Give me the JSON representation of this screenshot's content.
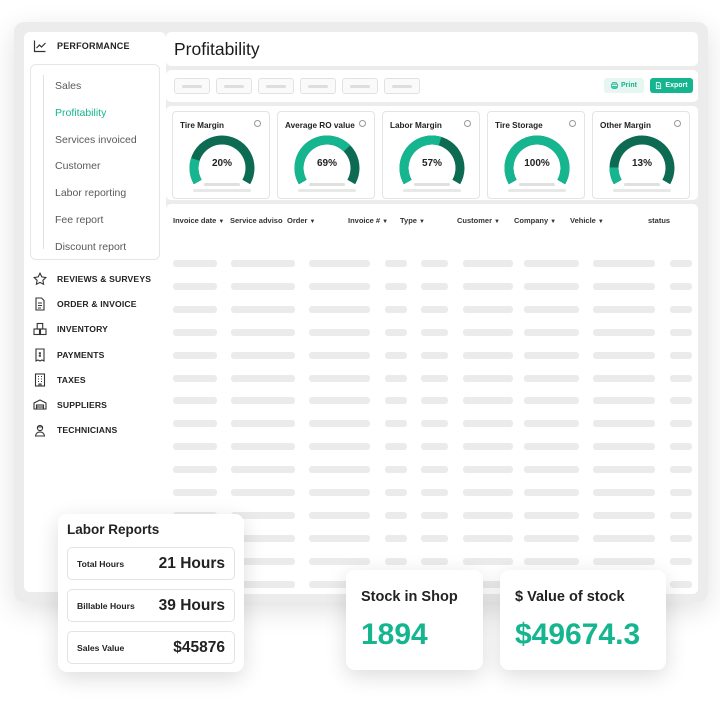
{
  "colors": {
    "accent": "#14b58f",
    "accent_dark": "#0d6b53",
    "accent_light": "#e6f6f1"
  },
  "sidebar": {
    "header": {
      "label": "PERFORMANCE",
      "icon": "trend-chart-icon"
    },
    "submenu": [
      {
        "label": "Sales"
      },
      {
        "label": "Profitability",
        "active": true
      },
      {
        "label": "Services invoiced"
      },
      {
        "label": "Customer"
      },
      {
        "label": "Labor reporting"
      },
      {
        "label": "Fee report"
      },
      {
        "label": "Discount report"
      }
    ],
    "items": [
      {
        "label": "REVIEWS & SURVEYS",
        "icon": "star-icon"
      },
      {
        "label": "ORDER & INVOICE",
        "icon": "document-icon"
      },
      {
        "label": "INVENTORY",
        "icon": "boxes-icon"
      },
      {
        "label": "PAYMENTS",
        "icon": "receipt-icon"
      },
      {
        "label": "TAXES",
        "icon": "building-icon"
      },
      {
        "label": "SUPPLIERS",
        "icon": "truck-icon"
      },
      {
        "label": "TECHNICIANS",
        "icon": "technician-icon"
      }
    ]
  },
  "page": {
    "title": "Profitability"
  },
  "toolbar": {
    "print_label": "Print",
    "export_label": "Export"
  },
  "kpis": [
    {
      "title": "Tire Margin",
      "value": "20%",
      "fill": 0.2
    },
    {
      "title": "Average RO value",
      "value": "69%",
      "fill": 0.69
    },
    {
      "title": "Labor Margin",
      "value": "57%",
      "fill": 0.57
    },
    {
      "title": "Tire Storage",
      "value": "100%",
      "fill": 1.0
    },
    {
      "title": "Other Margin",
      "value": "13%",
      "fill": 0.13
    }
  ],
  "table": {
    "columns": [
      {
        "label": "Invoice date",
        "sortable": true
      },
      {
        "label": "Service adviso",
        "sortable": false
      },
      {
        "label": "Order",
        "sortable": true
      },
      {
        "label": "Invoice #",
        "sortable": true
      },
      {
        "label": "Type",
        "sortable": true
      },
      {
        "label": "Customer",
        "sortable": true
      },
      {
        "label": "Company",
        "sortable": true
      },
      {
        "label": "Vehicle",
        "sortable": true
      },
      {
        "label": "status",
        "sortable": false
      }
    ]
  },
  "labor_reports": {
    "title": "Labor Reports",
    "rows": [
      {
        "label": "Total Hours",
        "value": "21 Hours"
      },
      {
        "label": "Billable Hours",
        "value": "39 Hours"
      },
      {
        "label": "Sales Value",
        "value": "$45876"
      }
    ]
  },
  "stock_in_shop": {
    "title": "Stock in Shop",
    "value": "1894"
  },
  "value_of_stock": {
    "title": "$ Value of stock",
    "value": "$49674.3"
  }
}
